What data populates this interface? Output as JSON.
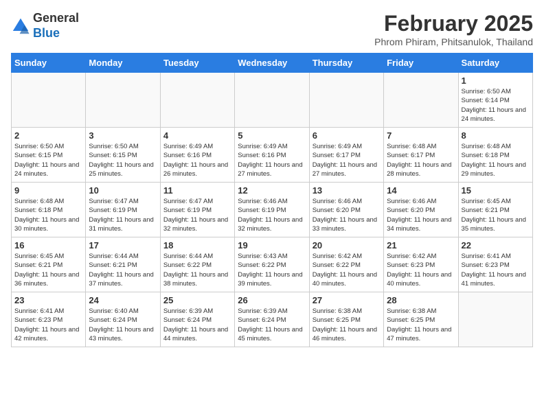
{
  "logo": {
    "general": "General",
    "blue": "Blue"
  },
  "title": "February 2025",
  "subtitle": "Phrom Phiram, Phitsanulok, Thailand",
  "days_of_week": [
    "Sunday",
    "Monday",
    "Tuesday",
    "Wednesday",
    "Thursday",
    "Friday",
    "Saturday"
  ],
  "weeks": [
    [
      {
        "day": "",
        "info": ""
      },
      {
        "day": "",
        "info": ""
      },
      {
        "day": "",
        "info": ""
      },
      {
        "day": "",
        "info": ""
      },
      {
        "day": "",
        "info": ""
      },
      {
        "day": "",
        "info": ""
      },
      {
        "day": "1",
        "info": "Sunrise: 6:50 AM\nSunset: 6:14 PM\nDaylight: 11 hours and 24 minutes."
      }
    ],
    [
      {
        "day": "2",
        "info": "Sunrise: 6:50 AM\nSunset: 6:15 PM\nDaylight: 11 hours and 24 minutes."
      },
      {
        "day": "3",
        "info": "Sunrise: 6:50 AM\nSunset: 6:15 PM\nDaylight: 11 hours and 25 minutes."
      },
      {
        "day": "4",
        "info": "Sunrise: 6:49 AM\nSunset: 6:16 PM\nDaylight: 11 hours and 26 minutes."
      },
      {
        "day": "5",
        "info": "Sunrise: 6:49 AM\nSunset: 6:16 PM\nDaylight: 11 hours and 27 minutes."
      },
      {
        "day": "6",
        "info": "Sunrise: 6:49 AM\nSunset: 6:17 PM\nDaylight: 11 hours and 27 minutes."
      },
      {
        "day": "7",
        "info": "Sunrise: 6:48 AM\nSunset: 6:17 PM\nDaylight: 11 hours and 28 minutes."
      },
      {
        "day": "8",
        "info": "Sunrise: 6:48 AM\nSunset: 6:18 PM\nDaylight: 11 hours and 29 minutes."
      }
    ],
    [
      {
        "day": "9",
        "info": "Sunrise: 6:48 AM\nSunset: 6:18 PM\nDaylight: 11 hours and 30 minutes."
      },
      {
        "day": "10",
        "info": "Sunrise: 6:47 AM\nSunset: 6:19 PM\nDaylight: 11 hours and 31 minutes."
      },
      {
        "day": "11",
        "info": "Sunrise: 6:47 AM\nSunset: 6:19 PM\nDaylight: 11 hours and 32 minutes."
      },
      {
        "day": "12",
        "info": "Sunrise: 6:46 AM\nSunset: 6:19 PM\nDaylight: 11 hours and 32 minutes."
      },
      {
        "day": "13",
        "info": "Sunrise: 6:46 AM\nSunset: 6:20 PM\nDaylight: 11 hours and 33 minutes."
      },
      {
        "day": "14",
        "info": "Sunrise: 6:46 AM\nSunset: 6:20 PM\nDaylight: 11 hours and 34 minutes."
      },
      {
        "day": "15",
        "info": "Sunrise: 6:45 AM\nSunset: 6:21 PM\nDaylight: 11 hours and 35 minutes."
      }
    ],
    [
      {
        "day": "16",
        "info": "Sunrise: 6:45 AM\nSunset: 6:21 PM\nDaylight: 11 hours and 36 minutes."
      },
      {
        "day": "17",
        "info": "Sunrise: 6:44 AM\nSunset: 6:21 PM\nDaylight: 11 hours and 37 minutes."
      },
      {
        "day": "18",
        "info": "Sunrise: 6:44 AM\nSunset: 6:22 PM\nDaylight: 11 hours and 38 minutes."
      },
      {
        "day": "19",
        "info": "Sunrise: 6:43 AM\nSunset: 6:22 PM\nDaylight: 11 hours and 39 minutes."
      },
      {
        "day": "20",
        "info": "Sunrise: 6:42 AM\nSunset: 6:22 PM\nDaylight: 11 hours and 40 minutes."
      },
      {
        "day": "21",
        "info": "Sunrise: 6:42 AM\nSunset: 6:23 PM\nDaylight: 11 hours and 40 minutes."
      },
      {
        "day": "22",
        "info": "Sunrise: 6:41 AM\nSunset: 6:23 PM\nDaylight: 11 hours and 41 minutes."
      }
    ],
    [
      {
        "day": "23",
        "info": "Sunrise: 6:41 AM\nSunset: 6:23 PM\nDaylight: 11 hours and 42 minutes."
      },
      {
        "day": "24",
        "info": "Sunrise: 6:40 AM\nSunset: 6:24 PM\nDaylight: 11 hours and 43 minutes."
      },
      {
        "day": "25",
        "info": "Sunrise: 6:39 AM\nSunset: 6:24 PM\nDaylight: 11 hours and 44 minutes."
      },
      {
        "day": "26",
        "info": "Sunrise: 6:39 AM\nSunset: 6:24 PM\nDaylight: 11 hours and 45 minutes."
      },
      {
        "day": "27",
        "info": "Sunrise: 6:38 AM\nSunset: 6:25 PM\nDaylight: 11 hours and 46 minutes."
      },
      {
        "day": "28",
        "info": "Sunrise: 6:38 AM\nSunset: 6:25 PM\nDaylight: 11 hours and 47 minutes."
      },
      {
        "day": "",
        "info": ""
      }
    ]
  ]
}
